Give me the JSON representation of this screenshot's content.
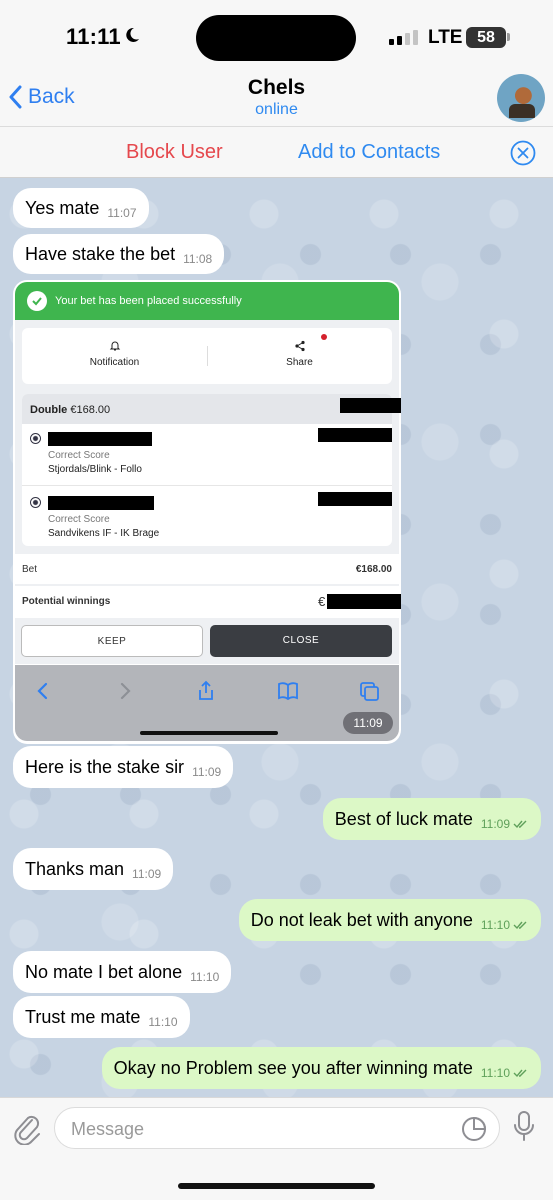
{
  "status_bar": {
    "time": "11:11",
    "network": "LTE",
    "battery": "58"
  },
  "header": {
    "back_label": "Back",
    "title": "Chels",
    "status": "online"
  },
  "action_bar": {
    "block_label": "Block User",
    "add_label": "Add to Contacts"
  },
  "messages": [
    {
      "text": "Yes mate",
      "time": "11:07"
    },
    {
      "text": "Have stake the bet",
      "time": "11:08"
    },
    {
      "text": "Here is the stake sir",
      "time": "11:09"
    },
    {
      "text": "Best of luck mate",
      "time": "11:09"
    },
    {
      "text": "Thanks man",
      "time": "11:09"
    },
    {
      "text": "Do not leak bet with anyone",
      "time": "11:10"
    },
    {
      "text": "No mate I bet alone",
      "time": "11:10"
    },
    {
      "text": "Trust me mate",
      "time": "11:10"
    },
    {
      "text": "Okay no Problem see you after winning mate",
      "time": "11:10"
    }
  ],
  "photo": {
    "success_text": "Your bet has been placed successfully",
    "tab_notification": "Notification",
    "tab_share": "Share",
    "bet_type": "Double",
    "bet_amount": "€168.00",
    "selections": [
      {
        "market": "Correct Score",
        "match": "Stjordals/Blink - Follo"
      },
      {
        "market": "Correct Score",
        "match": "Sandvikens IF - IK Brage"
      }
    ],
    "bet_label": "Bet",
    "bet_value": "€168.00",
    "winnings_label": "Potential winnings",
    "winnings_prefix": "€",
    "keep_label": "KEEP",
    "close_label": "CLOSE",
    "time": "11:09"
  },
  "input": {
    "placeholder": "Message"
  },
  "colors": {
    "accent": "#2f8af0",
    "danger": "#e5484d",
    "outgoing_bubble": "#dcf8c6",
    "success_green": "#3fb54e",
    "chat_background": "#c7d4e3"
  }
}
